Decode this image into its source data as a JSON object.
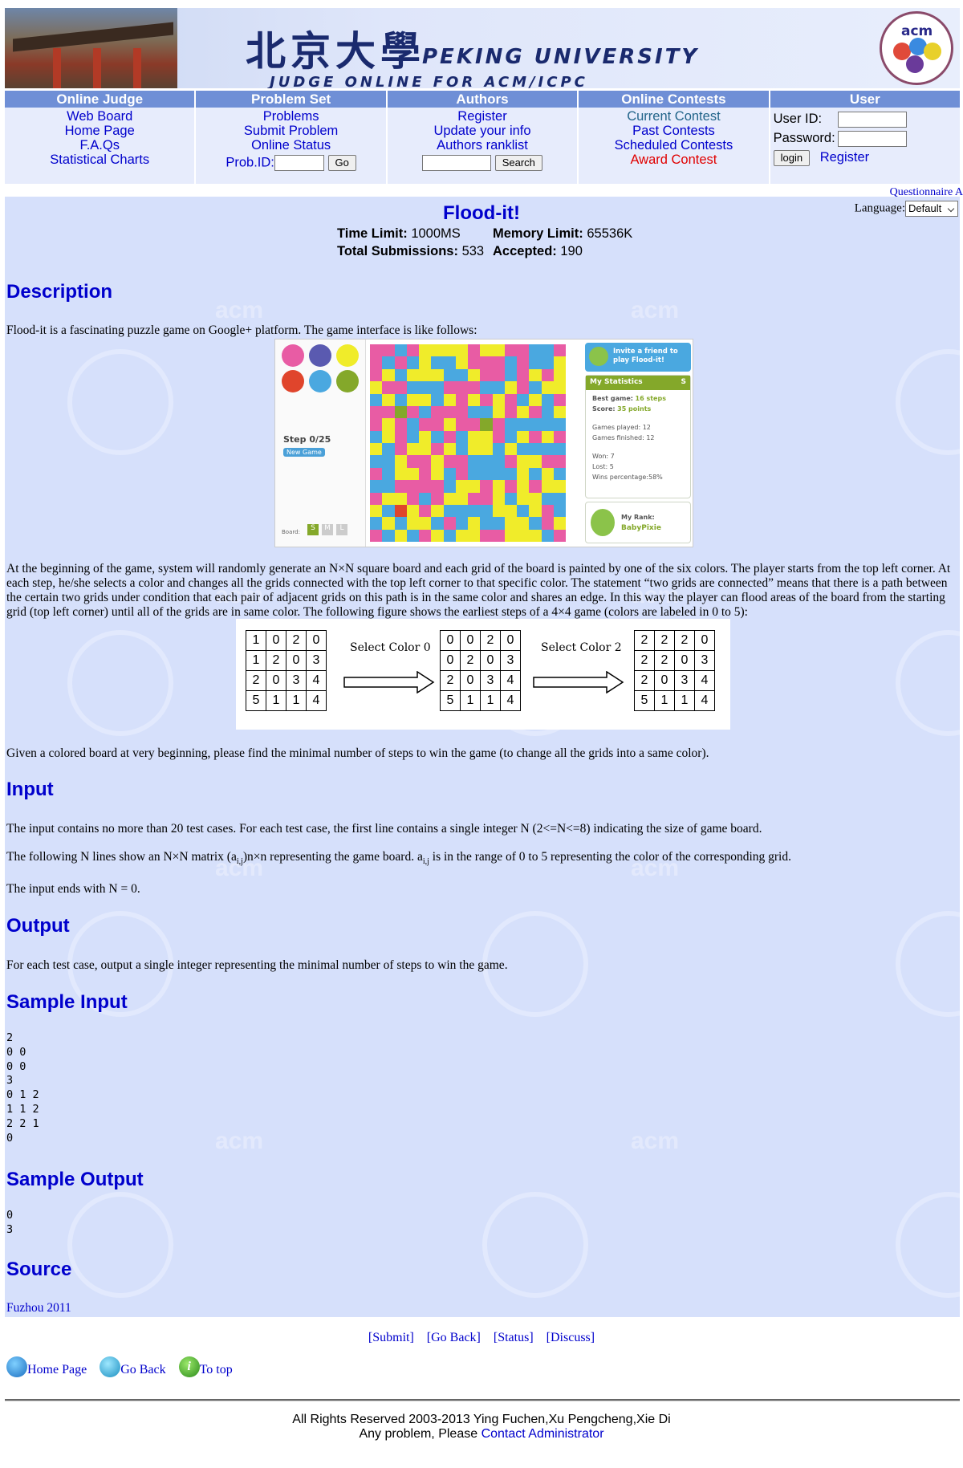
{
  "banner": {
    "chinese_name": "北京大學",
    "name": "PEKING UNIVERSITY",
    "subtitle": "JUDGE ONLINE FOR ACM/ICPC",
    "logo_text": "acm"
  },
  "nav": {
    "online_judge": {
      "title": "Online Judge",
      "items": [
        "Web Board",
        "Home Page",
        "F.A.Qs",
        "Statistical Charts"
      ]
    },
    "problem_set": {
      "title": "Problem Set",
      "items": [
        "Problems",
        "Submit Problem",
        "Online Status"
      ],
      "prob_id_label": "Prob.ID:",
      "go_label": "Go"
    },
    "authors": {
      "title": "Authors",
      "items": [
        "Register",
        "Update your info",
        "Authors ranklist"
      ],
      "search_label": "Search"
    },
    "online_contests": {
      "title": "Online Contests",
      "items": [
        "Current Contest",
        "Past Contests",
        "Scheduled Contests",
        "Award Contest"
      ]
    },
    "user": {
      "title": "User",
      "user_id_label": "User ID:",
      "password_label": "Password:",
      "login_label": "login",
      "register_label": "Register"
    }
  },
  "questionnaire": "Questionnaire A",
  "language": {
    "label": "Language:",
    "selected": "Default"
  },
  "problem": {
    "title": "Flood-it!",
    "time_limit_label": "Time Limit:",
    "time_limit": "1000MS",
    "memory_limit_label": "Memory Limit:",
    "memory_limit": "65536K",
    "total_submissions_label": "Total Submissions:",
    "total_submissions": "533",
    "accepted_label": "Accepted:",
    "accepted": "190"
  },
  "sections": {
    "description": "Description",
    "input": "Input",
    "output": "Output",
    "sample_input": "Sample Input",
    "sample_output": "Sample Output",
    "source": "Source"
  },
  "description": {
    "p1": "Flood-it is a fascinating puzzle game on Google+ platform. The game interface is like follows:",
    "p2": "At the beginning of the game, system will randomly generate an N×N square board and each grid of the board is painted by one of the six colors. The player starts from the top left corner. At each step, he/she selects a color and changes all the grids connected with the top left corner to that specific color. The statement “two grids are connected” means that there is a path between the certain two grids under condition that each pair of adjacent grids on this path is in the same color and shares an edge. In this way the player can flood areas of the board from the starting grid (top left corner) until all of the grids are in same color. The following figure shows the earliest steps of a 4×4 game (colors are labeled in 0 to 5):",
    "p3": "Given a colored board at very beginning, please find the minimal number of steps to win the game (to change all the grids into a same color)."
  },
  "game_image": {
    "step": "Step 0/25",
    "new_game": "New Game",
    "board_label": "Board:",
    "sizes": [
      "S",
      "M",
      "L"
    ],
    "invite": "Invite a friend to play Flood-it!",
    "stats_title": "My Statistics",
    "stats_s": "S",
    "best_game_label": "Best game:",
    "best_game": "16 steps",
    "score_label": "Score:",
    "score": "35 points",
    "games_played": "Games played: 12",
    "games_finished": "Games finished: 12",
    "won": "Won: 7",
    "lost": "Lost: 5",
    "wins_pct": "Wins percentage:58%",
    "rank_label": "My Rank:",
    "rank": "BabyPixie",
    "ball_colors": [
      "#e85ca4",
      "#5a5ab0",
      "#f0ec2a",
      "#e0452c",
      "#4aa8e0",
      "#84a82a"
    ]
  },
  "figure": {
    "select0": "Select Color 0",
    "select2": "Select Color 2",
    "m1": [
      [
        "1",
        "0",
        "2",
        "0"
      ],
      [
        "1",
        "2",
        "0",
        "3"
      ],
      [
        "2",
        "0",
        "3",
        "4"
      ],
      [
        "5",
        "1",
        "1",
        "4"
      ]
    ],
    "m2": [
      [
        "0",
        "0",
        "2",
        "0"
      ],
      [
        "0",
        "2",
        "0",
        "3"
      ],
      [
        "2",
        "0",
        "3",
        "4"
      ],
      [
        "5",
        "1",
        "1",
        "4"
      ]
    ],
    "m3": [
      [
        "2",
        "2",
        "2",
        "0"
      ],
      [
        "2",
        "2",
        "0",
        "3"
      ],
      [
        "2",
        "0",
        "3",
        "4"
      ],
      [
        "5",
        "1",
        "1",
        "4"
      ]
    ]
  },
  "input_text": {
    "p1": "The input contains no more than 20 test cases. For each test case, the first line contains a single integer N (2<=N<=8) indicating the size of game board.",
    "p2_a": "The following N lines show an N×N matrix (a",
    "p2_sub1": "i,j",
    "p2_b": ")n×n representing the game board. a",
    "p2_sub2": "i,j",
    "p2_c": " is in the range of 0 to 5 representing the color of the corresponding grid.",
    "p3": "The input ends with N = 0."
  },
  "output_text": "For each test case, output a single integer representing the minimal number of steps to win the game.",
  "sample_input": "2\n0 0\n0 0\n3\n0 1 2\n1 1 2\n2 2 1\n0",
  "sample_output": "0\n3",
  "source": "Fuzhou 2011",
  "bottom_links": [
    "[Submit]",
    "[Go Back]",
    "[Status]",
    "[Discuss]"
  ],
  "bottom_nav": [
    "Home Page",
    "Go Back",
    "To top"
  ],
  "footer": {
    "line1": "All Rights Reserved 2003-2013 Ying Fuchen,Xu Pengcheng,Xie Di",
    "line2_prefix": "Any problem, Please ",
    "contact": "Contact Administrator"
  }
}
